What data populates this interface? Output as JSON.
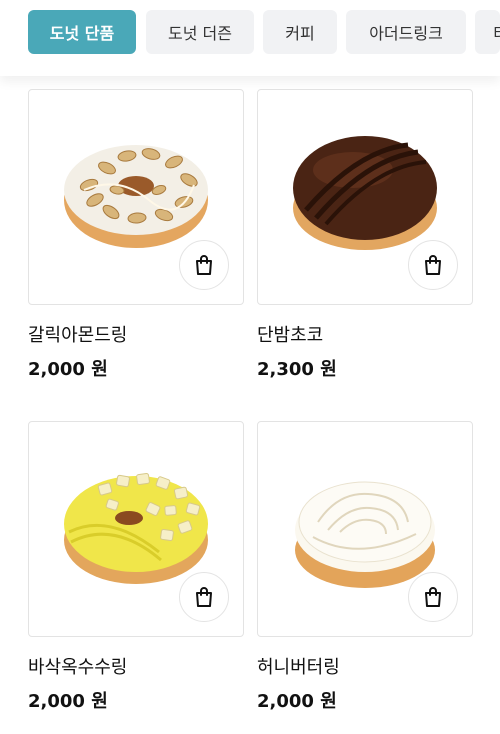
{
  "tabs": [
    {
      "label": "도넛 단품",
      "active": true
    },
    {
      "label": "도넛 더즌",
      "active": false
    },
    {
      "label": "커피",
      "active": false
    },
    {
      "label": "아더드링크",
      "active": false
    },
    {
      "label": "티",
      "active": false
    }
  ],
  "products": [
    {
      "name": "갈릭아몬드링",
      "price": "2,000 원",
      "icon": "shopping-bag-icon"
    },
    {
      "name": "단밤초코",
      "price": "2,300 원",
      "icon": "shopping-bag-icon"
    },
    {
      "name": "바삭옥수수링",
      "price": "2,000 원",
      "icon": "shopping-bag-icon"
    },
    {
      "name": "허니버터링",
      "price": "2,000 원",
      "icon": "shopping-bag-icon"
    }
  ],
  "colors": {
    "accent": "#4aa8b8",
    "tab_bg": "#f1f2f4"
  }
}
